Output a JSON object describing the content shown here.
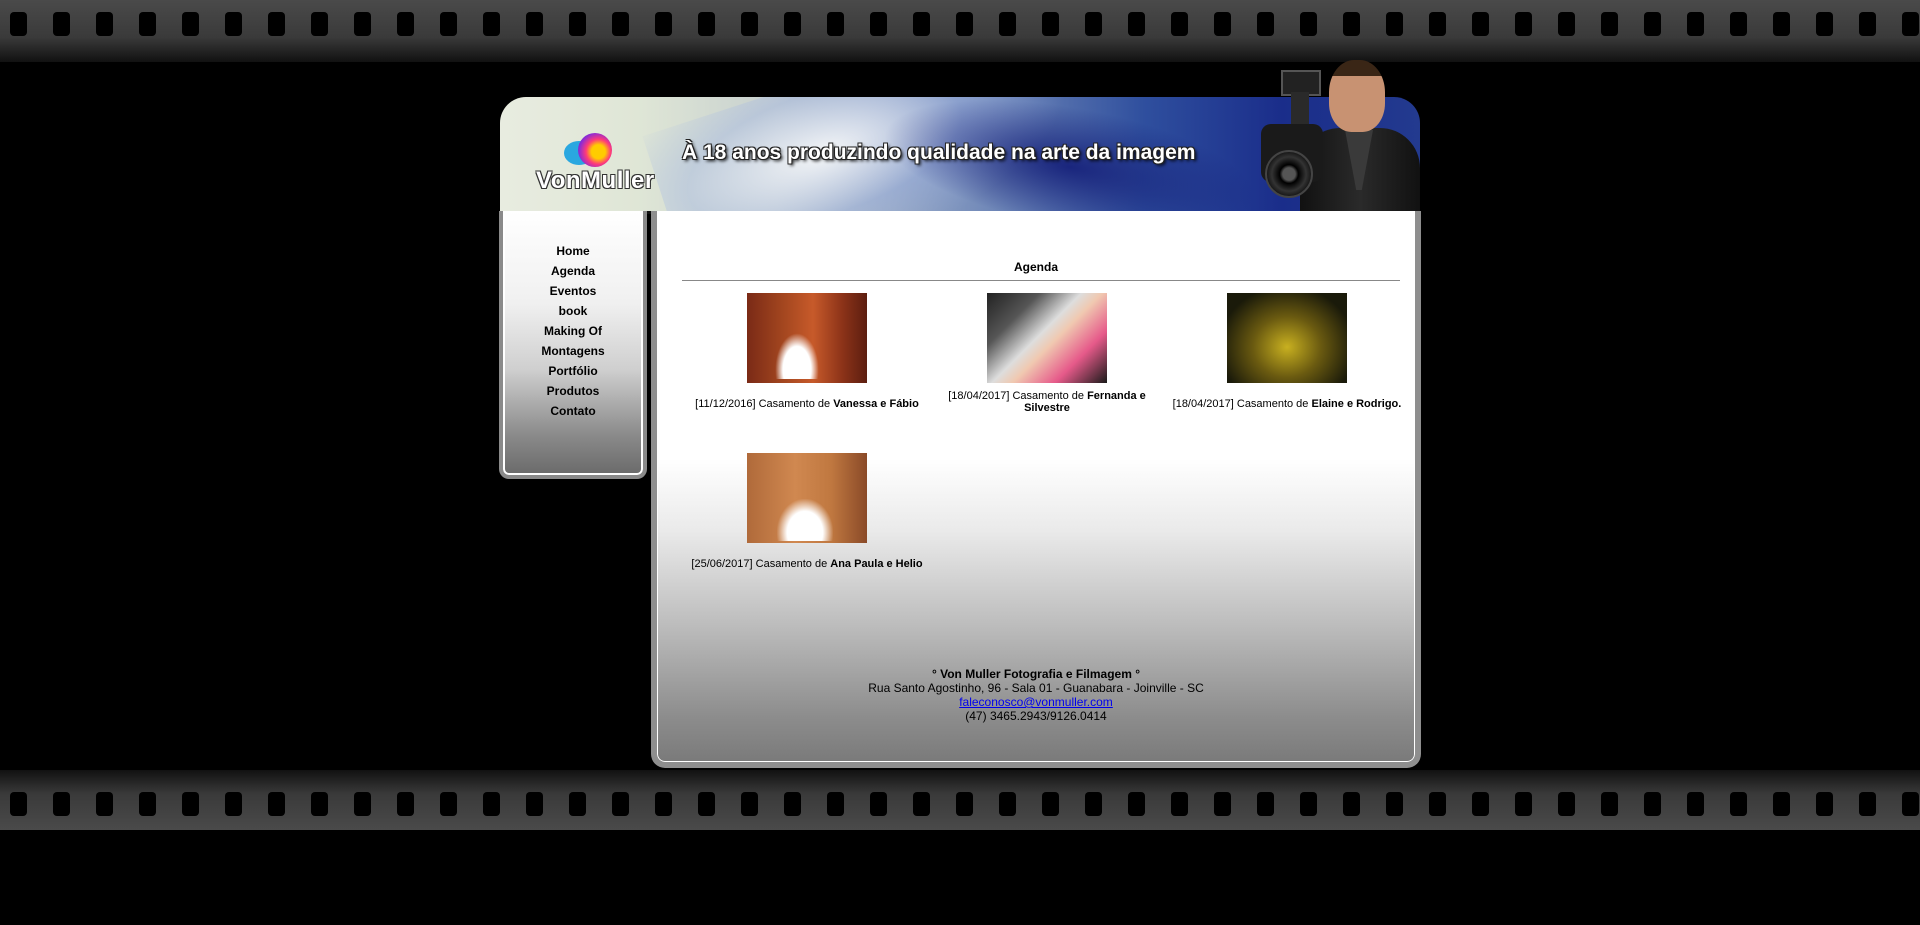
{
  "header": {
    "logo_text": "VonMuller",
    "tagline": "À 18 anos produzindo qualidade na arte da imagem"
  },
  "menu": {
    "items": [
      {
        "label": "Home"
      },
      {
        "label": "Agenda"
      },
      {
        "label": "Eventos"
      },
      {
        "label": "book"
      },
      {
        "label": "Making Of"
      },
      {
        "label": "Montagens"
      },
      {
        "label": "Portfólio"
      },
      {
        "label": "Produtos"
      },
      {
        "label": "Contato"
      }
    ]
  },
  "main": {
    "title": "Agenda",
    "events": [
      {
        "date": "[11/12/2016]",
        "prefix": "Casamento de",
        "names": "Vanessa e Fábio"
      },
      {
        "date": "[18/04/2017]",
        "prefix": "Casamento de",
        "names": "Fernanda e Silvestre"
      },
      {
        "date": "[18/04/2017]",
        "prefix": "Casamento de",
        "names": "Elaine e Rodrigo."
      },
      {
        "date": "[25/06/2017]",
        "prefix": "Casamento de",
        "names": "Ana Paula e Helio"
      }
    ]
  },
  "footer": {
    "brand": "° Von Muller Fotografia e Filmagem °",
    "address": "Rua Santo Agostinho, 96 - Sala 01 - Guanabara - Joinville - SC",
    "email": "faleconosco@vonmuller.com",
    "phone": "(47) 3465.2943/9126.0414"
  }
}
